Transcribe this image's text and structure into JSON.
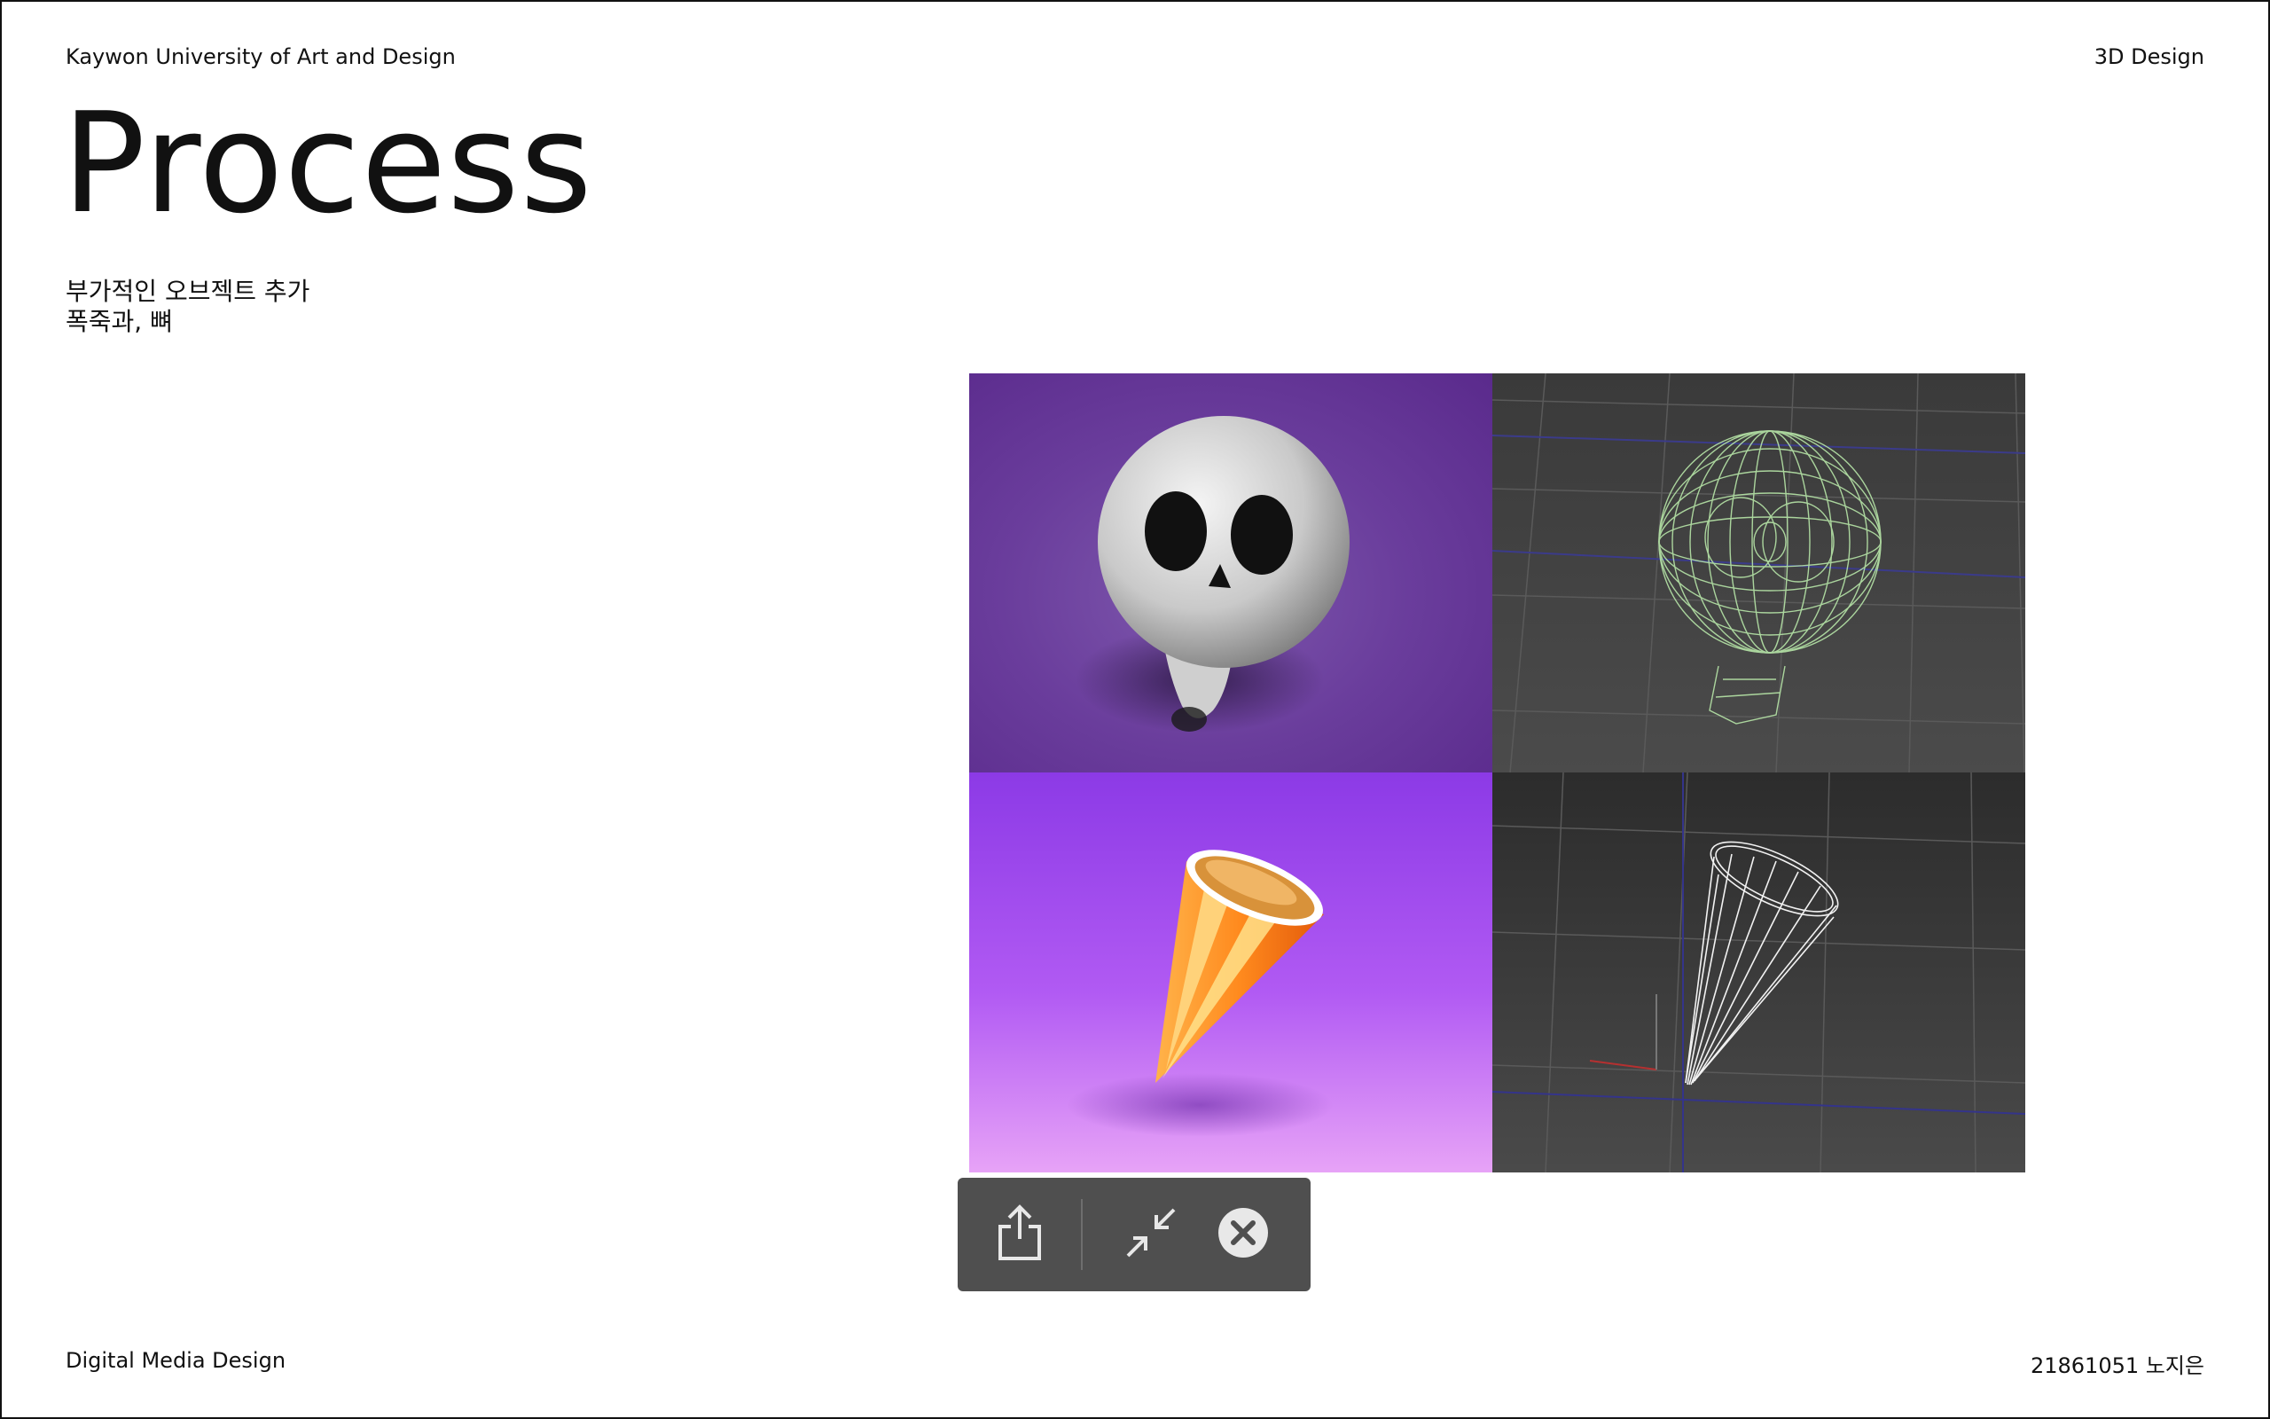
{
  "header": {
    "left": "Kaywon University of Art and Design",
    "right": "3D Design"
  },
  "slide": {
    "title": "Process",
    "subtitle_lines": [
      "부가적인 오브젝트 추가",
      "폭죽과, 뼈"
    ]
  },
  "footer": {
    "left": "Digital Media Design",
    "right": "21861051 노지은"
  },
  "figure": {
    "panels": [
      {
        "name": "skull-render",
        "background": "#6a3d9c"
      },
      {
        "name": "skull-wireframe",
        "background": "#454545"
      },
      {
        "name": "firecracker-render",
        "background": "#b15af3"
      },
      {
        "name": "firecracker-wireframe",
        "background": "#3a3a3a"
      }
    ]
  },
  "toolbar": {
    "buttons": [
      "share-icon",
      "exit-fullscreen-icon",
      "close-icon"
    ],
    "background": "#4f4f4f"
  }
}
